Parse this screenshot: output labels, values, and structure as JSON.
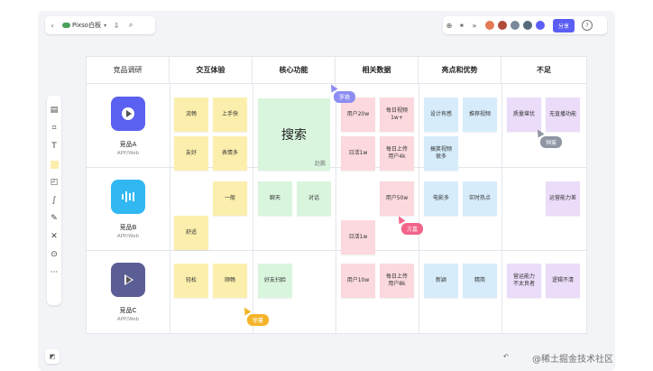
{
  "app": {
    "name": "Pixso白板"
  },
  "toolbar_right": {
    "share_label": "分享",
    "help_label": "?"
  },
  "headers": [
    "竞品调研",
    "交互体验",
    "核心功能",
    "相关数据",
    "亮点和优势",
    "不足"
  ],
  "competitors": [
    {
      "name": "竞品A",
      "sub": "APP/Web",
      "color": "#5a60f0"
    },
    {
      "name": "竞品B",
      "sub": "APP/Web",
      "color": "#31b8f2"
    },
    {
      "name": "竞品C",
      "sub": "APP/Web",
      "color": "#5b5e95"
    }
  ],
  "notes": {
    "a_jiaohu_1": "流畅",
    "a_jiaohu_2": "上手快",
    "a_jiaohu_3": "友好",
    "a_jiaohu_4": "表情多",
    "a_search": "搜索",
    "a_search_tag": "赵鹏",
    "a_data_1": "用户20w",
    "a_data_2": "每日视频\n1w+",
    "a_data_3": "日活1w",
    "a_data_4": "每日上传\n用户4k",
    "a_adv_1": "设计有感",
    "a_adv_2": "推荐视频",
    "a_adv_3": "搞笑视频\n很多",
    "a_bad_1": "质量堪忧",
    "a_bad_2": "无直播功能",
    "b_jiaohu_1": "一般",
    "b_jiaohu_2": "舒适",
    "b_core_1": "聊天",
    "b_core_2": "对话",
    "b_data_1": "用户50w",
    "b_data_2": "日活1w",
    "b_adv_1": "电影多",
    "b_adv_2": "实时热点",
    "b_bad_1": "运营能力差",
    "c_jiaohu_1": "轻松",
    "c_jiaohu_2": "顺畅",
    "c_core_1": "好友扫脸",
    "c_data_1": "用户10w",
    "c_data_2": "每日上传\n用户8k",
    "c_adv_1": "新颖",
    "c_adv_2": "精简",
    "c_bad_1": "营运能力\n不太良者",
    "c_bad_2": "逻辑不清"
  },
  "cursors": {
    "c1": "罗艳",
    "c2": "钟宸",
    "c3": "方嘉",
    "c4": "徐蔓"
  },
  "watermark": "@稀土掘金技术社区",
  "colors": {
    "accent": "#5b5ef5",
    "yellow": "#fcefad",
    "green": "#d9f5de",
    "pink": "#fbd9de",
    "blue": "#d6ecfb",
    "violet": "#ebdcf9"
  }
}
